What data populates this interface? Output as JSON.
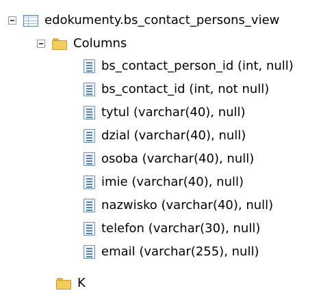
{
  "tree": {
    "view_name": "edokumenty.bs_contact_persons_view",
    "folder_label": "Columns",
    "columns": [
      {
        "label": "bs_contact_person_id (int, null)"
      },
      {
        "label": "bs_contact_id (int, not null)"
      },
      {
        "label": "tytul (varchar(40), null)"
      },
      {
        "label": "dzial (varchar(40), null)"
      },
      {
        "label": "osoba (varchar(40), null)"
      },
      {
        "label": "imie (varchar(40), null)"
      },
      {
        "label": "nazwisko (varchar(40), null)"
      },
      {
        "label": "telefon (varchar(30), null)"
      },
      {
        "label": "email (varchar(255), null)"
      }
    ],
    "next_folder_label": "K"
  },
  "icons": {
    "expander": "collapse-minus-icon",
    "view": "view-table-icon",
    "folder": "folder-icon",
    "column": "column-icon"
  }
}
